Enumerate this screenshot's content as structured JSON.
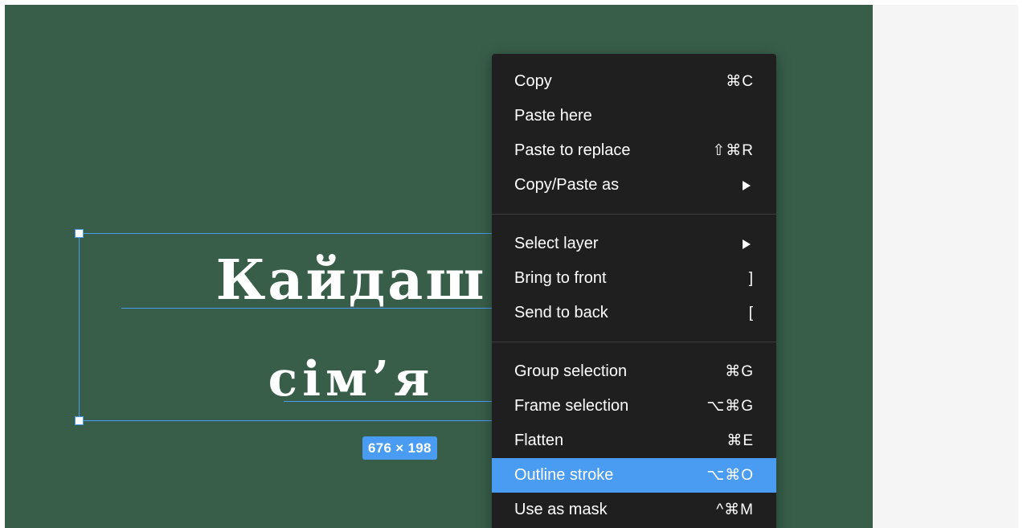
{
  "colors": {
    "canvas_bg": "#385e4a",
    "selection": "#4a9cf2",
    "menu_bg": "#1f1f1f",
    "menu_highlight": "#4a9cf2",
    "side_panel": "#f5f5f5"
  },
  "canvas": {
    "headline_line1": "Кайдаш",
    "headline_line2": "сім’я",
    "size_badge": "676 × 198"
  },
  "context_menu": {
    "groups": [
      [
        {
          "label": "Copy",
          "shortcut": "⌘C"
        },
        {
          "label": "Paste here",
          "shortcut": ""
        },
        {
          "label": "Paste to replace",
          "shortcut": "⇧⌘R"
        },
        {
          "label": "Copy/Paste as",
          "submenu": true
        }
      ],
      [
        {
          "label": "Select layer",
          "submenu": true
        },
        {
          "label": "Bring to front",
          "shortcut": "]"
        },
        {
          "label": "Send to back",
          "shortcut": "["
        }
      ],
      [
        {
          "label": "Group selection",
          "shortcut": "⌘G"
        },
        {
          "label": "Frame selection",
          "shortcut": "⌥⌘G"
        },
        {
          "label": "Flatten",
          "shortcut": "⌘E"
        },
        {
          "label": "Outline stroke",
          "shortcut": "⌥⌘O",
          "active": true
        },
        {
          "label": "Use as mask",
          "shortcut": "^⌘M"
        }
      ]
    ]
  }
}
